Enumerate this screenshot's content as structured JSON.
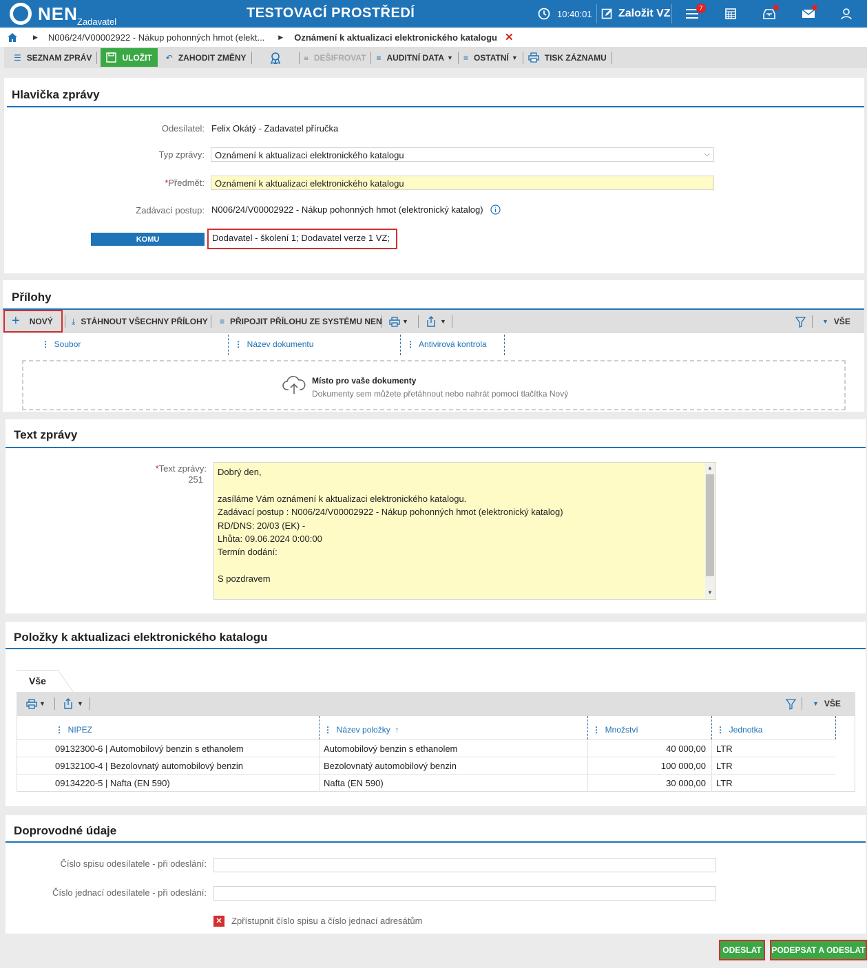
{
  "app": {
    "logo_text": "NEN",
    "role": "Zadavatel",
    "environment": "TESTOVACÍ PROSTŘEDÍ",
    "time": "10:40:01",
    "create_label": "Založit VZ",
    "notifications_count": "7"
  },
  "breadcrumb": {
    "item1": "N006/24/V00002922 - Nákup pohonných hmot (elekt...",
    "item2": "Oznámení k aktualizaci elektronického katalogu"
  },
  "toolbar": {
    "list": "SEZNAM ZPRÁV",
    "save": "ULOŽIT",
    "discard": "ZAHODIT ZMĚNY",
    "decrypt": "DEŠIFROVAT",
    "audit": "AUDITNÍ DATA",
    "other": "OSTATNÍ",
    "print": "TISK ZÁZNAMU"
  },
  "header": {
    "title": "Hlavička zprávy",
    "sender_label": "Odesílatel:",
    "sender": "Felix Okátý - Zadavatel příručka",
    "type_label": "Typ zprávy:",
    "type": "Oznámení k aktualizaci elektronického katalogu",
    "subject_label": "Předmět:",
    "subject": "Oznámení k aktualizaci elektronického katalogu",
    "procedure_label": "Zadávací postup:",
    "procedure": "N006/24/V00002922 - Nákup pohonných hmot (elektronický katalog)",
    "to_button": "KOMU",
    "to_value": "Dodavatel - školení 1; Dodavatel verze 1 VZ;"
  },
  "attachments": {
    "title": "Přílohy",
    "new": "NOVÝ",
    "download_all": "STÁHNOUT VŠECHNY PŘÍLOHY",
    "attach_system": "PŘIPOJIT PŘÍLOHU ZE SYSTÉMU NEN",
    "all": "VŠE",
    "columns": [
      "Soubor",
      "Název dokumentu",
      "Antivirová kontrola"
    ],
    "drop_title": "Místo pro vaše dokumenty",
    "drop_sub": "Dokumenty sem můžete přetáhnout nebo nahrát pomocí tlačítka Nový"
  },
  "message": {
    "title": "Text zprávy",
    "label": "Text zprávy:",
    "count": "251",
    "lines": [
      "Dobrý den,",
      "",
      "zasíláme Vám oznámení k aktualizaci elektronického katalogu.",
      "Zadávací postup : N006/24/V00002922 - Nákup pohonných hmot (elektronický katalog)",
      "RD/DNS: 20/03 (EK) -",
      "Lhůta: 09.06.2024 0:00:00",
      "Termín dodání:",
      "",
      "S pozdravem"
    ]
  },
  "items": {
    "title": "Položky k aktualizaci elektronického katalogu",
    "tab": "Vše",
    "all": "VŠE",
    "columns": [
      "NIPEZ",
      "Název položky",
      "Množství",
      "Jednotka"
    ],
    "rows": [
      [
        "09132300-6 | Automobilový benzin s ethanolem",
        "Automobilový benzin s ethanolem",
        "40 000,00",
        "LTR"
      ],
      [
        "09132100-4 | Bezolovnatý automobilový benzin",
        "Bezolovnatý automobilový benzin",
        "100 000,00",
        "LTR"
      ],
      [
        "09134220-5 | Nafta (EN 590)",
        "Nafta (EN 590)",
        "30 000,00",
        "LTR"
      ]
    ]
  },
  "extra": {
    "title": "Doprovodné údaje",
    "file_no_label": "Číslo spisu odesílatele - při odeslání:",
    "ref_no_label": "Číslo jednací odesílatele - při odeslání:",
    "checkbox_label": "Zpřístupnit číslo spisu a číslo jednací adresátům"
  },
  "actions": {
    "send": "ODESLAT",
    "sign_send": "PODEPSAT A ODESLAT"
  },
  "colors": {
    "primary": "#1f73b7",
    "green": "#3aa845",
    "red": "#d32f2f",
    "yellow": "#fffbc6"
  }
}
